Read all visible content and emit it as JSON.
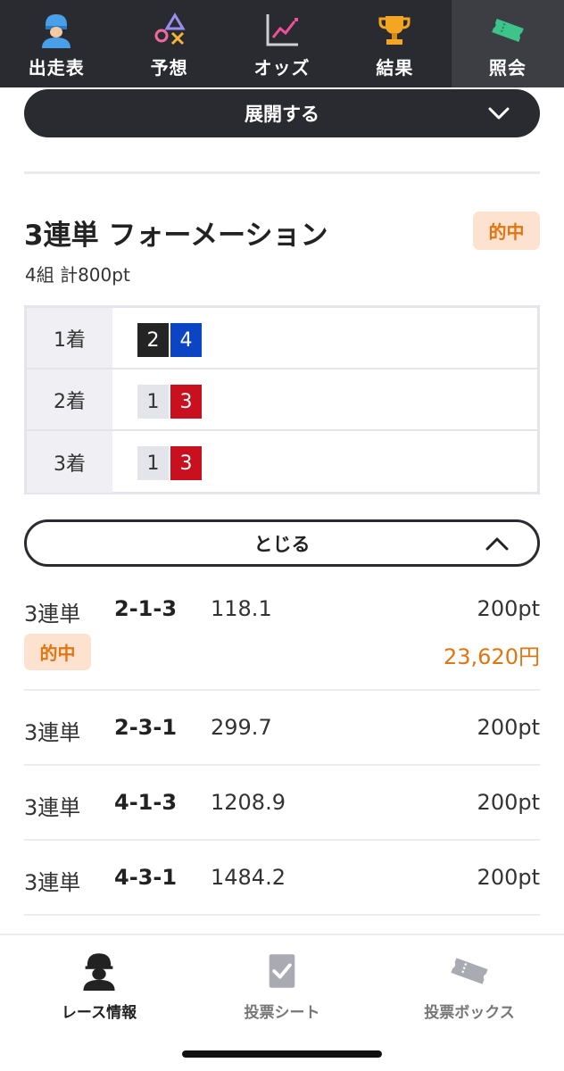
{
  "top_nav": {
    "items": [
      {
        "label": "出走表",
        "icon": "jockey-icon",
        "active": false
      },
      {
        "label": "予想",
        "icon": "prediction-shapes-icon",
        "active": false
      },
      {
        "label": "オッズ",
        "icon": "trend-chart-icon",
        "active": false
      },
      {
        "label": "結果",
        "icon": "trophy-icon",
        "active": false
      },
      {
        "label": "照会",
        "icon": "ticket-icon",
        "active": true
      }
    ]
  },
  "expand_bar": {
    "label": "展開する"
  },
  "bet": {
    "title": "3連単 フォーメーション",
    "hit_label": "的中",
    "summary": "4組 計800pt",
    "formation": [
      {
        "place": "1着",
        "numbers": [
          {
            "n": "2",
            "color": "black"
          },
          {
            "n": "4",
            "color": "blue"
          }
        ]
      },
      {
        "place": "2着",
        "numbers": [
          {
            "n": "1",
            "color": "white"
          },
          {
            "n": "3",
            "color": "red"
          }
        ]
      },
      {
        "place": "3着",
        "numbers": [
          {
            "n": "1",
            "color": "white"
          },
          {
            "n": "3",
            "color": "red"
          }
        ]
      }
    ]
  },
  "close_bar": {
    "label": "とじる"
  },
  "lines": [
    {
      "type": "3連単",
      "combo": "2-1-3",
      "odds": "118.1",
      "amount": "200pt",
      "hit": "的中",
      "payout": "23,620円"
    },
    {
      "type": "3連単",
      "combo": "2-3-1",
      "odds": "299.7",
      "amount": "200pt"
    },
    {
      "type": "3連単",
      "combo": "4-1-3",
      "odds": "1208.9",
      "amount": "200pt"
    },
    {
      "type": "3連単",
      "combo": "4-3-1",
      "odds": "1484.2",
      "amount": "200pt"
    }
  ],
  "bottom_nav": {
    "items": [
      {
        "label": "レース情報",
        "icon": "jockey-icon",
        "active": true
      },
      {
        "label": "投票シート",
        "icon": "checkmark-sheet-icon",
        "active": false
      },
      {
        "label": "投票ボックス",
        "icon": "ticket-icon",
        "active": false
      }
    ]
  },
  "colors": {
    "nav_bg": "#2a2b30",
    "hit_text": "#e07512",
    "hit_bg": "#fde3cf",
    "frame_black": "#242424",
    "frame_blue": "#0c45c4",
    "frame_red": "#c8101e",
    "frame_white": "#e4e5ea"
  }
}
